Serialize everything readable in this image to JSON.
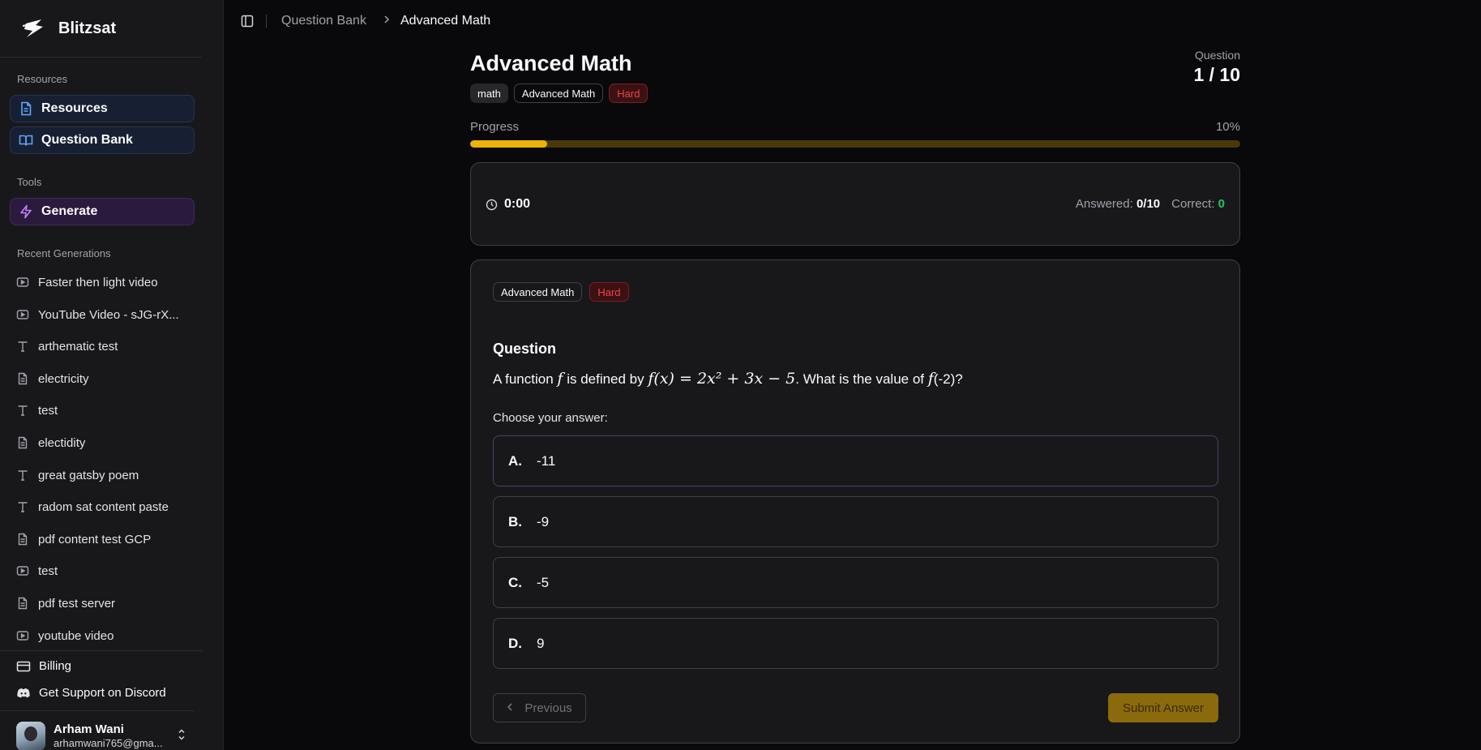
{
  "app": {
    "name": "Blitzsat"
  },
  "sidebar": {
    "resources_label": "Resources",
    "nav": [
      {
        "label": "Resources",
        "icon": "document-icon"
      },
      {
        "label": "Question Bank",
        "icon": "book-icon"
      }
    ],
    "tools_label": "Tools",
    "tools": [
      {
        "label": "Generate",
        "icon": "bolt-icon"
      }
    ],
    "recent_label": "Recent Generations",
    "recent": [
      {
        "label": "Faster then light video",
        "icon": "video-icon"
      },
      {
        "label": "YouTube Video - sJG-rX...",
        "icon": "video-icon"
      },
      {
        "label": "arthematic test",
        "icon": "text-icon"
      },
      {
        "label": "electricity",
        "icon": "document-icon"
      },
      {
        "label": "test",
        "icon": "text-icon"
      },
      {
        "label": "electidity",
        "icon": "document-icon"
      },
      {
        "label": "great gatsby poem",
        "icon": "text-icon"
      },
      {
        "label": "radom sat content paste",
        "icon": "text-icon"
      },
      {
        "label": "pdf content test GCP",
        "icon": "document-icon"
      },
      {
        "label": "test",
        "icon": "video-icon"
      },
      {
        "label": "pdf test server",
        "icon": "document-icon"
      },
      {
        "label": "youtube video",
        "icon": "video-icon"
      }
    ],
    "billing": "Billing",
    "support": "Get Support on Discord",
    "user": {
      "name": "Arham Wani",
      "email": "arhamwani765@gma..."
    }
  },
  "breadcrumb": {
    "parent": "Question Bank",
    "current": "Advanced Math"
  },
  "quiz": {
    "title": "Advanced Math",
    "tags": [
      "math",
      "Advanced Math",
      "Hard"
    ],
    "question_label": "Question",
    "question_count": "1 / 10",
    "progress_label": "Progress",
    "progress_pct_text": "10%",
    "progress_fraction": 0.1,
    "timer": "0:00",
    "answered_label": "Answered:",
    "answered_value": "0/10",
    "correct_label": "Correct:",
    "correct_value": "0"
  },
  "question": {
    "tags": [
      "Advanced Math",
      "Hard"
    ],
    "heading": "Question",
    "text_parts": [
      "A function",
      "is defined by",
      ". What is the value of",
      "(-2)?"
    ],
    "math_f": "f",
    "math_expr": "f(x) = 2x² + 3x − 5",
    "choose_label": "Choose your answer:",
    "options": [
      {
        "letter": "A.",
        "value": "-11"
      },
      {
        "letter": "B.",
        "value": "-9"
      },
      {
        "letter": "C.",
        "value": "-5"
      },
      {
        "letter": "D.",
        "value": "9"
      }
    ],
    "previous_label": "Previous",
    "submit_label": "Submit Answer"
  },
  "colors": {
    "accent": "#eab308",
    "hard": "#ef4444",
    "correct": "#22c55e",
    "background": "#09090b",
    "sidebar": "#18181b"
  }
}
